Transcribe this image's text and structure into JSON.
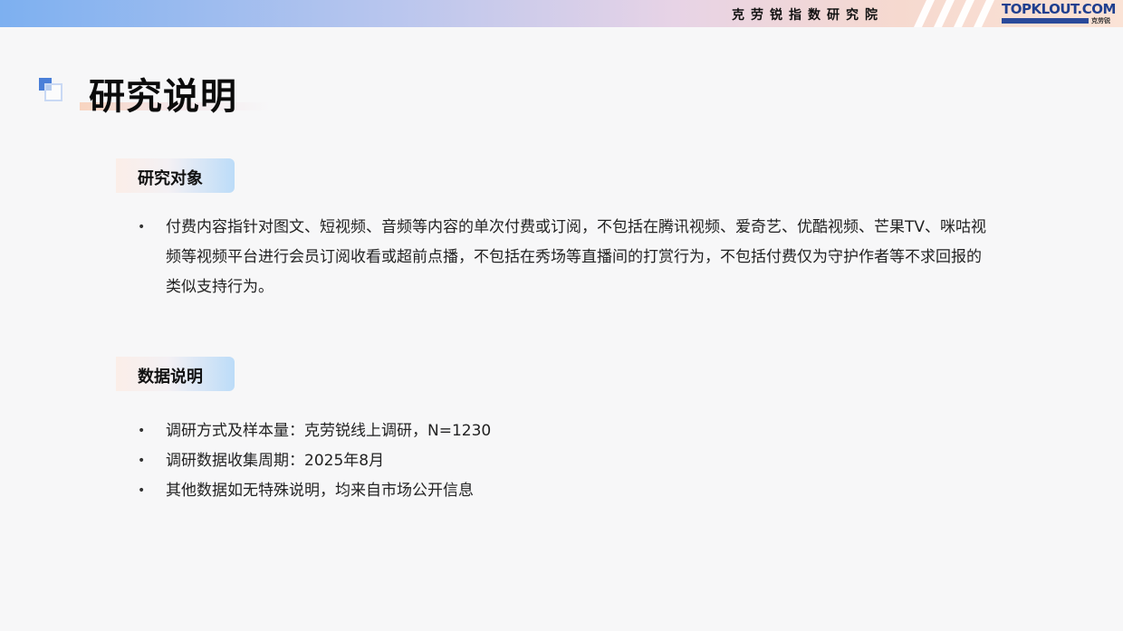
{
  "header": {
    "institute": "克劳锐指数研究院",
    "logo_text": "TOPKLOUT.COM",
    "logo_sub": "克劳锐"
  },
  "page": {
    "title": "研究说明"
  },
  "sections": [
    {
      "label": "研究对象",
      "bullets": [
        "付费内容指针对图文、短视频、音频等内容的单次付费或订阅，不包括在腾讯视频、爱奇艺、优酷视频、芒果TV、咪咕视频等视频平台进行会员订阅收看或超前点播，不包括在秀场等直播间的打赏行为，不包括付费仅为守护作者等不求回报的类似支持行为。"
      ]
    },
    {
      "label": "数据说明",
      "bullets": [
        "调研方式及样本量：克劳锐线上调研，N=1230",
        "调研数据收集周期：2025年8月",
        "其他数据如无特殊说明，均来自市场公开信息"
      ]
    }
  ],
  "colors": {
    "accent_blue": "#4a7fd8",
    "logo_blue": "#1f3f8f",
    "band_start": "#7db0f0",
    "band_end": "#fbe3d6"
  },
  "icons": [
    "title-square-icon",
    "bullet-dot-icon"
  ]
}
